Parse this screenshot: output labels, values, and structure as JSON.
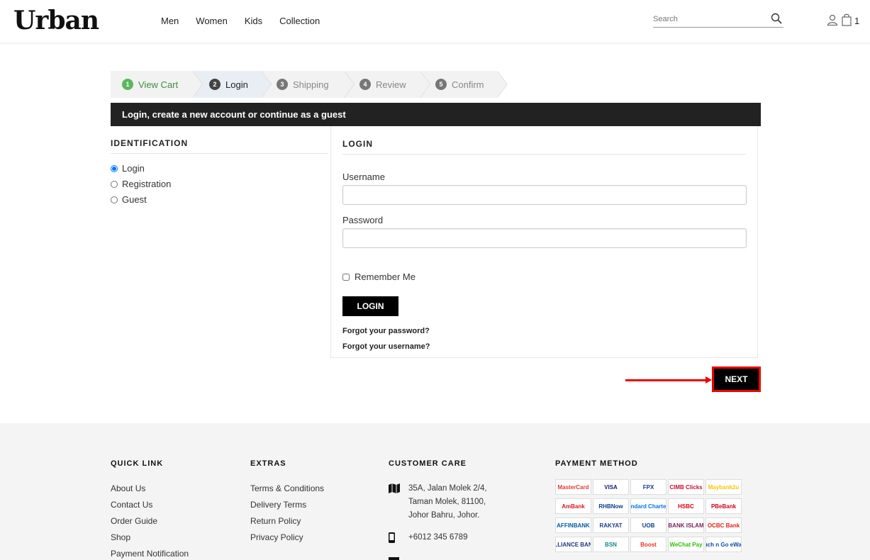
{
  "header": {
    "logo": "Urban",
    "nav": [
      "Men",
      "Women",
      "Kids",
      "Collection"
    ],
    "search_placeholder": "Search",
    "cart_count": "1"
  },
  "steps": [
    {
      "num": "1",
      "label": "View Cart",
      "state": "done"
    },
    {
      "num": "2",
      "label": "Login",
      "state": "active"
    },
    {
      "num": "3",
      "label": "Shipping",
      "state": "todo"
    },
    {
      "num": "4",
      "label": "Review",
      "state": "todo"
    },
    {
      "num": "5",
      "label": "Confirm",
      "state": "todo"
    }
  ],
  "title_bar": "Login, create a new account or continue as a guest",
  "identification": {
    "heading": "IDENTIFICATION",
    "options": [
      "Login",
      "Registration",
      "Guest"
    ],
    "selected": "Login"
  },
  "login": {
    "heading": "LOGIN",
    "username_label": "Username",
    "password_label": "Password",
    "remember_label": "Remember Me",
    "button": "LOGIN",
    "forgot_password": "Forgot your password?",
    "forgot_username": "Forgot your username?"
  },
  "next_button": "NEXT",
  "footer": {
    "quick_link": {
      "heading": "QUICK LINK",
      "items": [
        "About Us",
        "Contact Us",
        "Order Guide",
        "Shop",
        "Payment Notification"
      ]
    },
    "extras": {
      "heading": "EXTRAS",
      "items": [
        "Terms & Conditions",
        "Delivery Terms",
        "Return Policy",
        "Privacy Policy"
      ]
    },
    "customer_care": {
      "heading": "CUSTOMER CARE",
      "address": [
        "35A, Jalan Molek 2/4,",
        "Taman Molek, 81100,",
        "Johor Bahru, Johor."
      ],
      "phone": "+6012 345 6789"
    },
    "payment": {
      "heading": "PAYMENT METHOD",
      "methods": [
        "MasterCard",
        "VISA",
        "FPX",
        "CIMB Clicks",
        "Maybank2u",
        "AmBank",
        "RHBNow",
        "Standard Chartered",
        "HSBC",
        "PBeBank",
        "AFFINBANK",
        "RAKYAT",
        "UOB",
        "BANK ISLAM",
        "OCBC Bank",
        "ALLIANCE BANK",
        "BSN",
        "Boost",
        "WeChat Pay",
        "Touch n Go eWallet"
      ],
      "colors": [
        "#e8372c",
        "#1a1f71",
        "#1b3a8c",
        "#c8102e",
        "#f7c600",
        "#d71920",
        "#0d3c8a",
        "#0473ea",
        "#db0011",
        "#d6001c",
        "#005ba4",
        "#1a3e8c",
        "#0b3e91",
        "#7a1e5a",
        "#e2231a",
        "#1c3a7a",
        "#0a8a8a",
        "#ee2e24",
        "#2dc100",
        "#0f4aa8"
      ]
    }
  }
}
